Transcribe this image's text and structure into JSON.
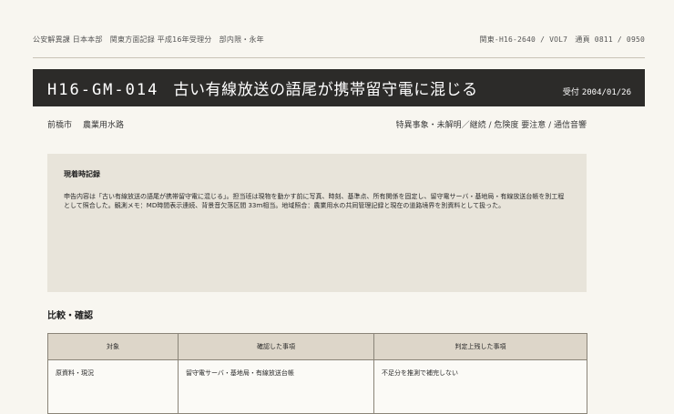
{
  "header": {
    "left": "公安解異課 日本本部　関東方面記録 平成16年受理分　部内限・永年",
    "right": "関東-H16-2640 / VOL7　通頁 0811 / 0950"
  },
  "title": {
    "code": "H16-GM-014",
    "text": "古い有線放送の語尾が携帯留守電に混じる",
    "date_label": "受付",
    "date": "2004/01/26"
  },
  "meta": {
    "place": "前橋市",
    "location": "農業用水路",
    "status": "特異事象・未解明／継続 / 危険度 要注意 / 通信音響"
  },
  "note": {
    "heading": "現着時記録",
    "body": "申告内容は「古い有線放送の語尾が携帯留守電に混じる」。担当班は現物を動かす前に写真、時刻、基準点、所有関係を固定し、留守電サーバ・基地局・有線放送台帳を別工程として照合した。観測メモ：MD時間表示連続、背景音欠落区間 33ｍ相当。地域照合：農業用水の共同管理記録と現在の道路境界を別資料として扱った。"
  },
  "section": {
    "title": "比較・確認"
  },
  "table": {
    "headers": [
      "対象",
      "確認した事項",
      "判定上残した事項"
    ],
    "rows": [
      [
        "原資料・現況",
        "留守電サーバ・基地局・有線放送台帳",
        "不足分を推測で補完しない"
      ]
    ]
  }
}
